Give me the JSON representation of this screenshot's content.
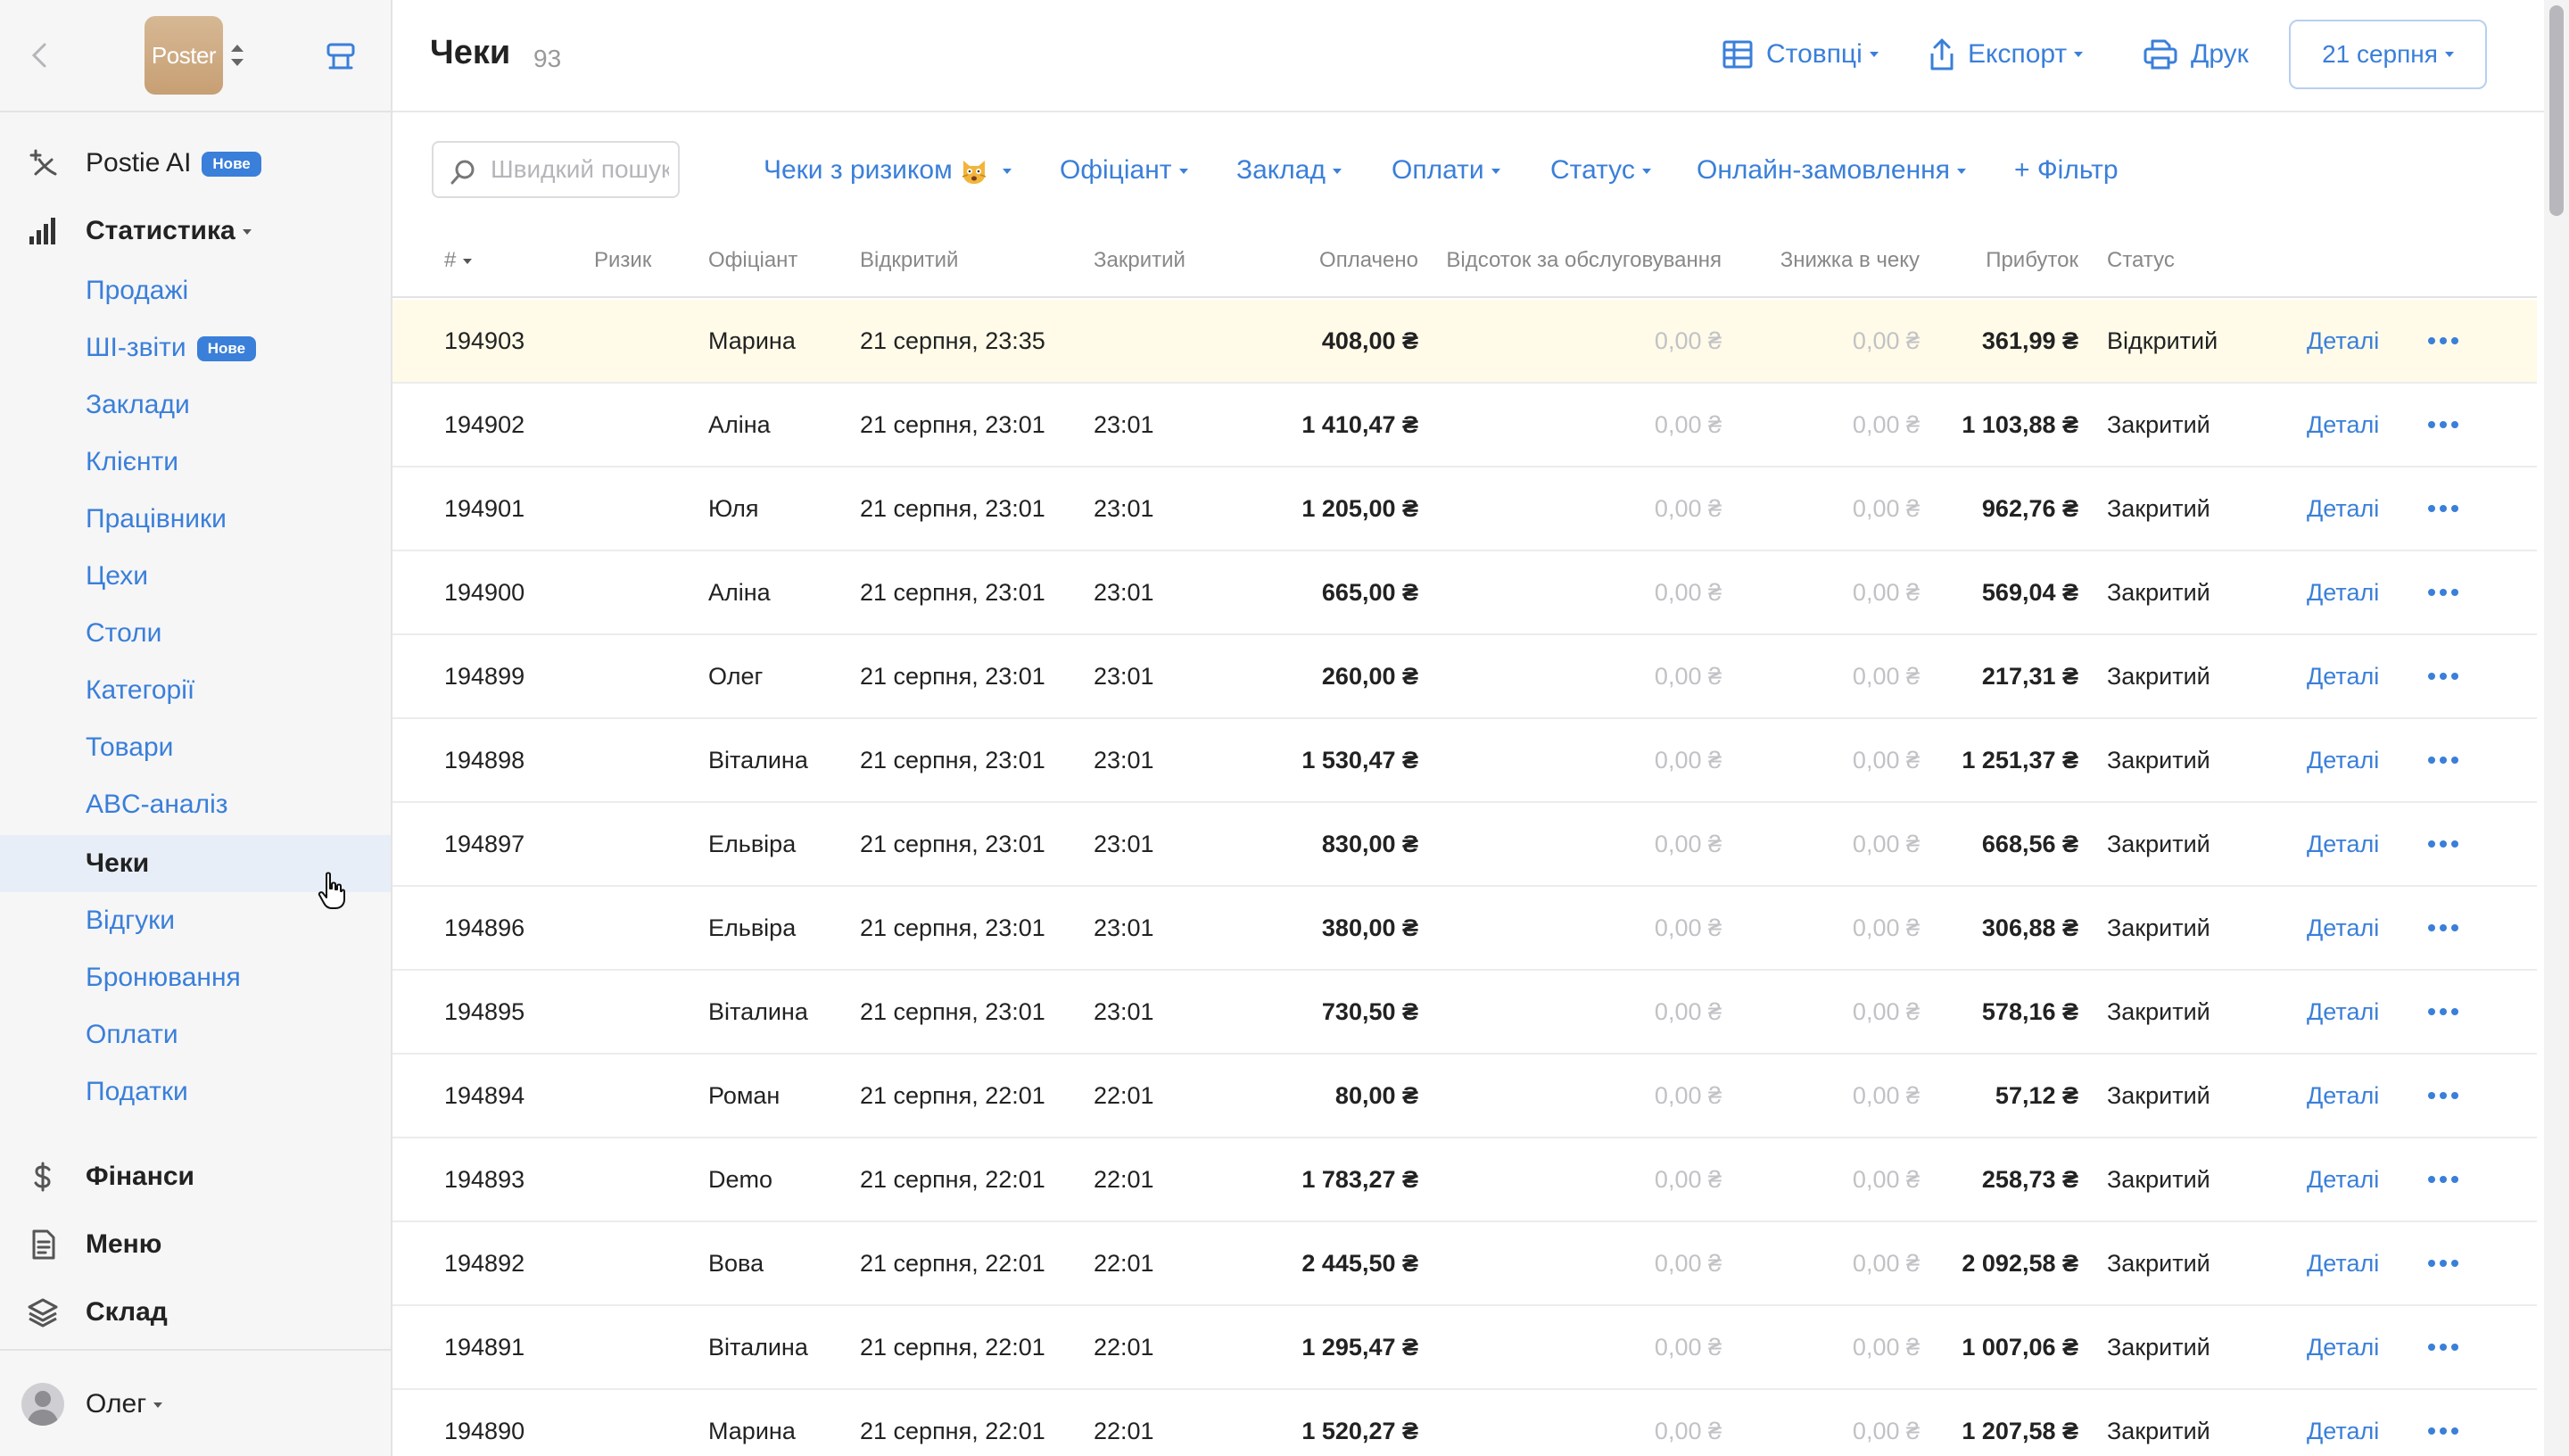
{
  "sidebar": {
    "logo_text": "Poster",
    "nav": [
      {
        "label": "Postie AI",
        "badge": "Нове"
      },
      {
        "label": "Статистика"
      },
      {
        "label": "Фінанси"
      },
      {
        "label": "Меню"
      },
      {
        "label": "Склад"
      }
    ],
    "stats_sub": [
      {
        "label": "Продажі"
      },
      {
        "label": "ШІ-звіти",
        "badge": "Нове"
      },
      {
        "label": "Заклади"
      },
      {
        "label": "Клієнти"
      },
      {
        "label": "Працівники"
      },
      {
        "label": "Цехи"
      },
      {
        "label": "Столи"
      },
      {
        "label": "Категорії"
      },
      {
        "label": "Товари"
      },
      {
        "label": "ABC-аналіз"
      },
      {
        "label": "Чеки",
        "active": true
      },
      {
        "label": "Відгуки"
      },
      {
        "label": "Бронювання"
      },
      {
        "label": "Оплати"
      },
      {
        "label": "Податки"
      }
    ],
    "user_name": "Олег"
  },
  "header": {
    "title": "Чеки",
    "count": "93",
    "columns_label": "Стовпці",
    "export_label": "Експорт",
    "print_label": "Друк",
    "date_label": "21 серпня"
  },
  "filters": {
    "search_placeholder": "Швидкий пошук",
    "items": [
      "Чеки з ризиком",
      "Офіціант",
      "Заклад",
      "Оплати",
      "Статус",
      "Онлайн-замовлення"
    ],
    "add_filter": "+ Фільтр"
  },
  "table": {
    "columns": [
      "#",
      "Ризик",
      "Офіціант",
      "Відкритий",
      "Закритий",
      "Оплачено",
      "Відсоток за обслуговування",
      "Знижка в чеку",
      "Прибуток",
      "Статус"
    ],
    "details_label": "Деталі",
    "rows": [
      {
        "id": "194903",
        "risk": "",
        "waiter": "Марина",
        "opened": "21 серпня, 23:35",
        "closed": "",
        "paid": "408,00 ₴",
        "service": "0,00 ₴",
        "discount": "0,00 ₴",
        "profit": "361,99 ₴",
        "status": "Відкритий",
        "highlight": true
      },
      {
        "id": "194902",
        "risk": "",
        "waiter": "Аліна",
        "opened": "21 серпня, 23:01",
        "closed": "23:01",
        "paid": "1 410,47 ₴",
        "service": "0,00 ₴",
        "discount": "0,00 ₴",
        "profit": "1 103,88 ₴",
        "status": "Закритий"
      },
      {
        "id": "194901",
        "risk": "",
        "waiter": "Юля",
        "opened": "21 серпня, 23:01",
        "closed": "23:01",
        "paid": "1 205,00 ₴",
        "service": "0,00 ₴",
        "discount": "0,00 ₴",
        "profit": "962,76 ₴",
        "status": "Закритий"
      },
      {
        "id": "194900",
        "risk": "",
        "waiter": "Аліна",
        "opened": "21 серпня, 23:01",
        "closed": "23:01",
        "paid": "665,00 ₴",
        "service": "0,00 ₴",
        "discount": "0,00 ₴",
        "profit": "569,04 ₴",
        "status": "Закритий"
      },
      {
        "id": "194899",
        "risk": "",
        "waiter": "Олег",
        "opened": "21 серпня, 23:01",
        "closed": "23:01",
        "paid": "260,00 ₴",
        "service": "0,00 ₴",
        "discount": "0,00 ₴",
        "profit": "217,31 ₴",
        "status": "Закритий"
      },
      {
        "id": "194898",
        "risk": "",
        "waiter": "Віталина",
        "opened": "21 серпня, 23:01",
        "closed": "23:01",
        "paid": "1 530,47 ₴",
        "service": "0,00 ₴",
        "discount": "0,00 ₴",
        "profit": "1 251,37 ₴",
        "status": "Закритий"
      },
      {
        "id": "194897",
        "risk": "",
        "waiter": "Ельвіра",
        "opened": "21 серпня, 23:01",
        "closed": "23:01",
        "paid": "830,00 ₴",
        "service": "0,00 ₴",
        "discount": "0,00 ₴",
        "profit": "668,56 ₴",
        "status": "Закритий"
      },
      {
        "id": "194896",
        "risk": "",
        "waiter": "Ельвіра",
        "opened": "21 серпня, 23:01",
        "closed": "23:01",
        "paid": "380,00 ₴",
        "service": "0,00 ₴",
        "discount": "0,00 ₴",
        "profit": "306,88 ₴",
        "status": "Закритий"
      },
      {
        "id": "194895",
        "risk": "",
        "waiter": "Віталина",
        "opened": "21 серпня, 23:01",
        "closed": "23:01",
        "paid": "730,50 ₴",
        "service": "0,00 ₴",
        "discount": "0,00 ₴",
        "profit": "578,16 ₴",
        "status": "Закритий"
      },
      {
        "id": "194894",
        "risk": "",
        "waiter": "Роман",
        "opened": "21 серпня, 22:01",
        "closed": "22:01",
        "paid": "80,00 ₴",
        "service": "0,00 ₴",
        "discount": "0,00 ₴",
        "profit": "57,12 ₴",
        "status": "Закритий"
      },
      {
        "id": "194893",
        "risk": "",
        "waiter": "Demo",
        "opened": "21 серпня, 22:01",
        "closed": "22:01",
        "paid": "1 783,27 ₴",
        "service": "0,00 ₴",
        "discount": "0,00 ₴",
        "profit": "258,73 ₴",
        "status": "Закритий"
      },
      {
        "id": "194892",
        "risk": "",
        "waiter": "Вова",
        "opened": "21 серпня, 22:01",
        "closed": "22:01",
        "paid": "2 445,50 ₴",
        "service": "0,00 ₴",
        "discount": "0,00 ₴",
        "profit": "2 092,58 ₴",
        "status": "Закритий"
      },
      {
        "id": "194891",
        "risk": "",
        "waiter": "Віталина",
        "opened": "21 серпня, 22:01",
        "closed": "22:01",
        "paid": "1 295,47 ₴",
        "service": "0,00 ₴",
        "discount": "0,00 ₴",
        "profit": "1 007,06 ₴",
        "status": "Закритий"
      },
      {
        "id": "194890",
        "risk": "",
        "waiter": "Марина",
        "opened": "21 серпня, 22:01",
        "closed": "22:01",
        "paid": "1 520,27 ₴",
        "service": "0,00 ₴",
        "discount": "0,00 ₴",
        "profit": "1 207,58 ₴",
        "status": "Закритий"
      }
    ]
  },
  "colors": {
    "accent": "#3a7fd9",
    "highlight_row": "#fffbe8",
    "active_nav": "#e8eef8"
  },
  "icons": {
    "back": "chevron-left-icon",
    "logo_switch": "sort-arrows-icon",
    "pos": "pos-terminal-icon",
    "postie": "ai-sparkle-icon",
    "stats": "bar-chart-icon",
    "finance": "dollar-icon",
    "menu": "document-icon",
    "warehouse": "layers-icon",
    "columns": "table-columns-icon",
    "export": "upload-icon",
    "print": "printer-icon",
    "search": "search-icon",
    "risk": "scared-cat-emoji-icon",
    "more": "ellipsis-icon"
  }
}
